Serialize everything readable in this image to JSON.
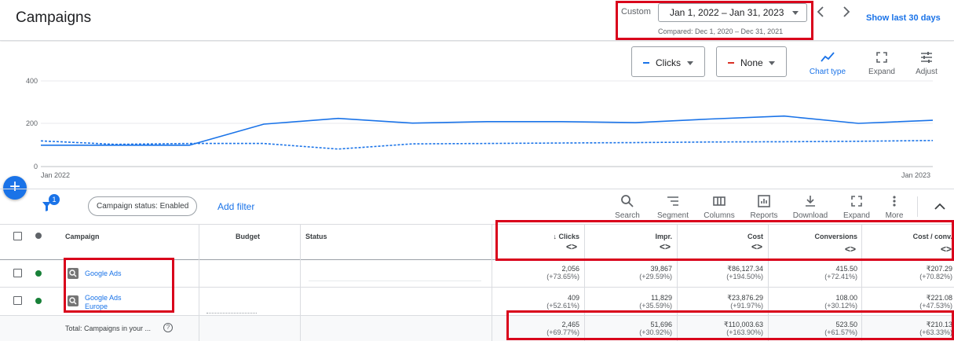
{
  "header": {
    "title": "Campaigns",
    "custom_label": "Custom",
    "date_range": "Jan 1, 2022 – Jan 31, 2023",
    "compared": "Compared: Dec 1, 2020 – Dec 31, 2021",
    "show_last": "Show last 30 days"
  },
  "chart_controls": {
    "metric1": "Clicks",
    "metric1_color": "#1a73e8",
    "metric2": "None",
    "metric2_color": "#d93025",
    "chart_type": "Chart type",
    "expand": "Expand",
    "adjust": "Adjust"
  },
  "chart_data": {
    "type": "line",
    "ylim": [
      0,
      400
    ],
    "yticks": [
      "400",
      "200",
      "0"
    ],
    "x_start_label": "Jan 2022",
    "x_end_label": "Jan 2023",
    "series": [
      {
        "style": "solid",
        "color": "#1a73e8",
        "values": [
          100,
          100,
          100,
          198,
          225,
          203,
          210,
          210,
          205,
          222,
          236,
          202,
          216
        ]
      },
      {
        "style": "dashed",
        "color": "#1a73e8",
        "values": [
          120,
          104,
          108,
          108,
          82,
          106,
          108,
          110,
          112,
          115,
          116,
          118,
          122
        ]
      }
    ]
  },
  "toolbar": {
    "filter_count": "1",
    "status_chip": "Campaign status: Enabled",
    "add_filter": "Add filter",
    "search": "Search",
    "segment": "Segment",
    "columns": "Columns",
    "reports": "Reports",
    "download": "Download",
    "expand": "Expand",
    "more": "More"
  },
  "table": {
    "headers": {
      "campaign": "Campaign",
      "budget": "Budget",
      "status": "Status",
      "clicks": "Clicks",
      "impr": "Impr.",
      "cost": "Cost",
      "conversions": "Conversions",
      "cost_conv": "Cost / conv."
    },
    "rows": [
      {
        "name": "Google Ads",
        "clicks": "2,056",
        "clicks_d": "(+73.65%)",
        "impr": "39,867",
        "impr_d": "(+29.59%)",
        "cost": "₹86,127.34",
        "cost_d": "(+194.50%)",
        "conv": "415.50",
        "conv_d": "(+72.41%)",
        "cpc": "₹207.29",
        "cpc_d": "(+70.82%)"
      },
      {
        "name_line1": "Google Ads",
        "name_line2": "Europe",
        "clicks": "409",
        "clicks_d": "(+52.61%)",
        "impr": "11,829",
        "impr_d": "(+35.59%)",
        "cost": "₹23,876.29",
        "cost_d": "(+91.97%)",
        "conv": "108.00",
        "conv_d": "(+30.12%)",
        "cpc": "₹221.08",
        "cpc_d": "(+47.53%)"
      }
    ],
    "total": {
      "label": "Total: Campaigns in your ...",
      "clicks": "2,465",
      "clicks_d": "(+69.77%)",
      "impr": "51,696",
      "impr_d": "(+30.92%)",
      "cost": "₹110,003.63",
      "cost_d": "(+163.90%)",
      "conv": "523.50",
      "conv_d": "(+61.57%)",
      "cpc": "₹210.13",
      "cpc_d": "(+63.33%)"
    }
  }
}
